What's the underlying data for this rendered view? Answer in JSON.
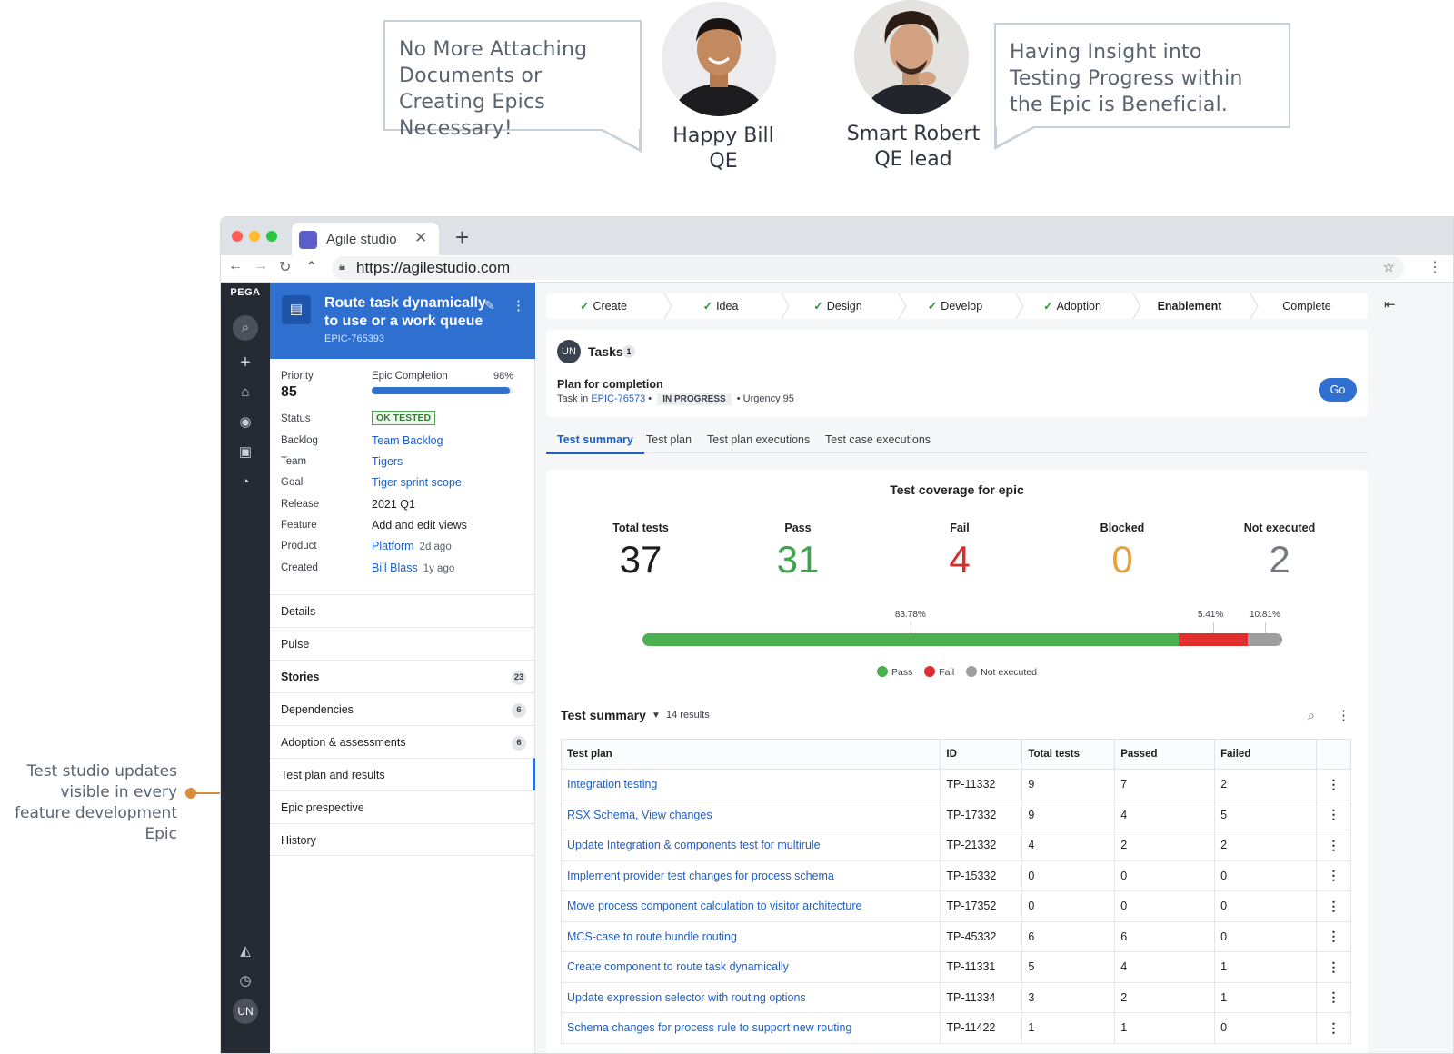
{
  "personas": {
    "left_quote": "No More Attaching Documents or Creating Epics Necessary!",
    "right_quote": "Having Insight into Testing Progress within the Epic is Beneficial.",
    "bill_name": "Happy Bill",
    "bill_role": "QE",
    "robert_name": "Smart Robert",
    "robert_role": "QE lead"
  },
  "side_note": "Test studio updates visible in every feature development Epic",
  "browser": {
    "tab_title": "Agile studio",
    "tab_close": "✕",
    "new_tab": "+",
    "url": "https://agilestudio.com"
  },
  "rail": {
    "logo": "PEGA",
    "user_initials": "UN"
  },
  "epic": {
    "title": "Route task dynamically to use or a work queue",
    "id": "EPIC-765393",
    "priority_label": "Priority",
    "priority_value": "85",
    "completion_label": "Epic Completion",
    "completion_text": "98%",
    "completion_value": 0.98,
    "fields": [
      {
        "label": "Status",
        "value": "OK TESTED"
      },
      {
        "label": "Backlog",
        "value": "Team Backlog"
      },
      {
        "label": "Team",
        "value": "Tigers"
      },
      {
        "label": "Goal",
        "value": "Tiger sprint scope"
      },
      {
        "label": "Release",
        "value": "2021 Q1"
      },
      {
        "label": "Feature",
        "value": "Add and edit views"
      },
      {
        "label": "Product",
        "value": "Platform",
        "sub": "2d ago"
      },
      {
        "label": "Created",
        "value": "Bill Blass",
        "sub": "1y ago"
      }
    ],
    "nav": [
      {
        "label": "Details"
      },
      {
        "label": "Pulse"
      },
      {
        "label": "Stories",
        "count": "23"
      },
      {
        "label": "Dependencies",
        "count": "6"
      },
      {
        "label": "Adoption & assessments",
        "count": "6"
      },
      {
        "label": "Test plan and results"
      },
      {
        "label": "Epic prespective"
      },
      {
        "label": "History"
      }
    ]
  },
  "stages": [
    "Create",
    "Idea",
    "Design",
    "Develop",
    "Adoption",
    "Enablement",
    "Complete"
  ],
  "tasks": {
    "avatar": "UN",
    "title": "Tasks",
    "count": "1",
    "task_name": "Plan for completion",
    "task_in": "Task in",
    "task_epic": "EPIC-76573",
    "task_status": "IN PROGRESS",
    "urgency": "Urgency 95",
    "go_label": "Go"
  },
  "tabs": [
    "Test summary",
    "Test plan",
    "Test plan executions",
    "Test case executions"
  ],
  "coverage": {
    "title": "Test coverage for epic",
    "metrics": [
      {
        "label": "Total tests",
        "value": "37",
        "color": "#1f1f1f"
      },
      {
        "label": "Pass",
        "value": "31",
        "color": "#3fa34d"
      },
      {
        "label": "Fail",
        "value": "4",
        "color": "#d32f2f"
      },
      {
        "label": "Blocked",
        "value": "0",
        "color": "#e6a23c"
      },
      {
        "label": "Not executed",
        "value": "2",
        "color": "#757a80"
      }
    ],
    "bar": [
      {
        "name": "Pass",
        "percent": 83.78,
        "label": "83.78%",
        "color": "#4caf50"
      },
      {
        "name": "Fail",
        "percent": 10.81,
        "label": "5.41%",
        "color": "#e02d2d"
      },
      {
        "name": "Not executed",
        "percent": 5.41,
        "label": "10.81%",
        "color": "#9e9e9e"
      }
    ],
    "legend": [
      "Pass",
      "Fail",
      "Not executed"
    ]
  },
  "summary": {
    "title": "Test summary",
    "results": "14 results",
    "columns": [
      "Test plan",
      "ID",
      "Total tests",
      "Passed",
      "Failed"
    ],
    "rows": [
      [
        "Integration testing",
        "TP-11332",
        "9",
        "7",
        "2"
      ],
      [
        "RSX Schema, View changes",
        "TP-17332",
        "9",
        "4",
        "5"
      ],
      [
        "Update Integration & components test for multirule",
        "TP-21332",
        "4",
        "2",
        "2"
      ],
      [
        "Implement provider test changes for process schema",
        "TP-15332",
        "0",
        "0",
        "0"
      ],
      [
        "Move process component calculation to visitor architecture",
        "TP-17352",
        "0",
        "0",
        "0"
      ],
      [
        "MCS-case to route bundle routing",
        "TP-45332",
        "6",
        "6",
        "0"
      ],
      [
        "Create component to route task dynamically",
        "TP-11331",
        "5",
        "4",
        "1"
      ],
      [
        "Update expression selector with routing options",
        "TP-11334",
        "3",
        "2",
        "1"
      ],
      [
        "Schema changes for process rule to support new routing",
        "TP-11422",
        "1",
        "1",
        "0"
      ]
    ]
  }
}
